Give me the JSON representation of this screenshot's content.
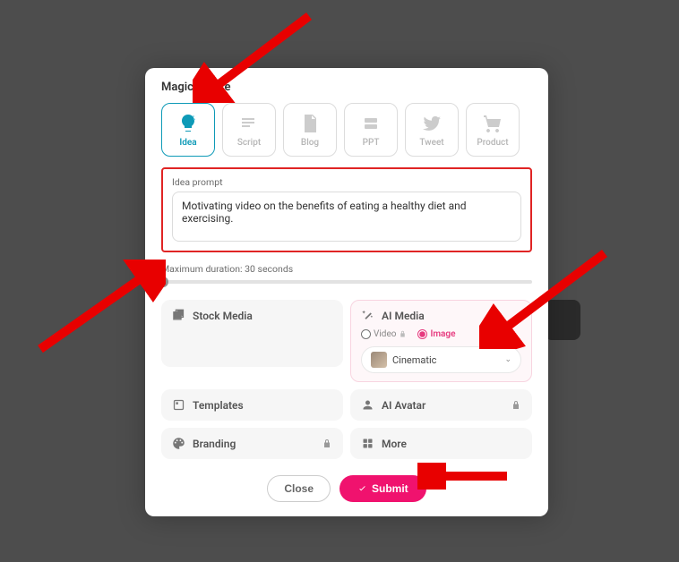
{
  "modal_title": "Magic Create",
  "tabs": {
    "idea": "Idea",
    "script": "Script",
    "blog": "Blog",
    "ppt": "PPT",
    "tweet": "Tweet",
    "product": "Product"
  },
  "prompt_label": "Idea prompt",
  "prompt_value": "Motivating video on the benefits of eating a healthy diet and exercising.",
  "duration_label": "Maximum duration: 30 seconds",
  "options": {
    "stock_media": "Stock Media",
    "ai_media": "AI Media",
    "templates": "Templates",
    "ai_avatar": "AI Avatar",
    "branding": "Branding",
    "more": "More"
  },
  "ai_media": {
    "radio_video": "Video",
    "radio_image": "Image",
    "dropdown_selected": "Cinematic"
  },
  "buttons": {
    "close": "Close",
    "submit": "Submit"
  }
}
